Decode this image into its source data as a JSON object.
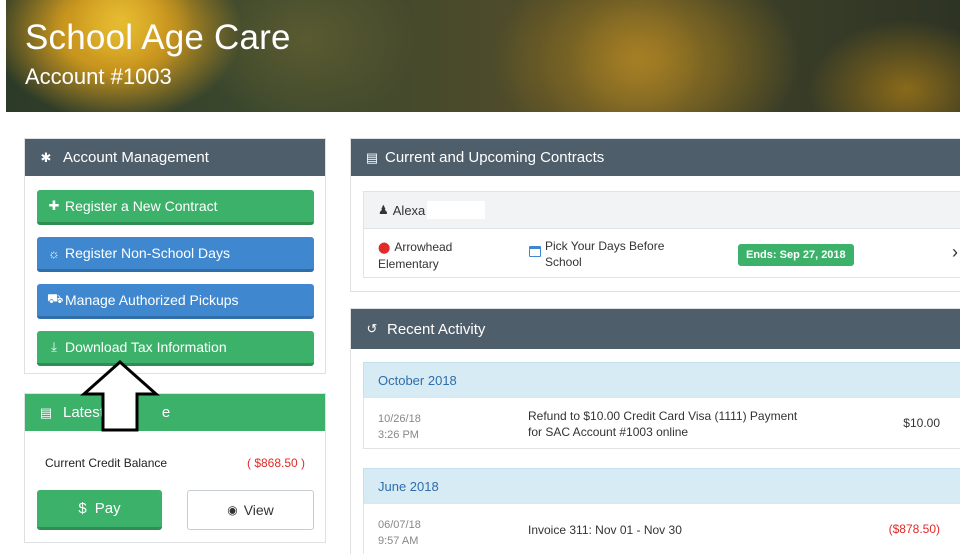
{
  "header": {
    "title": "School Age Care",
    "subtitle": "Account #1003"
  },
  "account_management": {
    "title": "Account Management",
    "icon": "gear-icon",
    "buttons": [
      {
        "label": "Register a New Contract",
        "icon": "plus-icon",
        "color": "#3cb16a"
      },
      {
        "label": "Register Non-School Days",
        "icon": "sun-icon",
        "color": "#3f88cf"
      },
      {
        "label": "Manage Authorized Pickups",
        "icon": "car-icon",
        "color": "#3f88cf"
      },
      {
        "label": "Download Tax Information",
        "icon": "download-icon",
        "color": "#3cb16a"
      }
    ]
  },
  "latest_invoice": {
    "title": "Latest",
    "title_tail": "e",
    "balance_label": "Current Credit Balance",
    "balance_value": "( $868.50 )",
    "pay_label": "Pay",
    "pay_symbol": "$",
    "view_label": "View"
  },
  "contracts": {
    "title": "Current and Upcoming Contracts",
    "child_name": "Alexa",
    "location_line1": "Arrowhead",
    "location_line2": "Elementary",
    "schedule_line1": "Pick Your Days Before",
    "schedule_line2": "School",
    "ends_badge": "Ends: Sep 27, 2018",
    "chevron": "›"
  },
  "activity": {
    "title": "Recent Activity",
    "groups": [
      {
        "month": "October 2018",
        "date": "10/26/18",
        "time": "3:26 PM",
        "desc_line1": "Refund to $10.00 Credit Card Visa (1111) Payment",
        "desc_line2": "for SAC Account #1003 online",
        "amount": "$10.00"
      },
      {
        "month": "June 2018",
        "date": "06/07/18",
        "time": "9:57 AM",
        "desc_line1": "Invoice 311: Nov 01 - Nov 30",
        "desc_line2": "",
        "amount": "($878.50)"
      }
    ]
  },
  "colors": {
    "accent_green": "#3cb16a",
    "accent_blue": "#3f88cf",
    "panel_header": "#4f5e6b",
    "negative": "#e02b27"
  }
}
